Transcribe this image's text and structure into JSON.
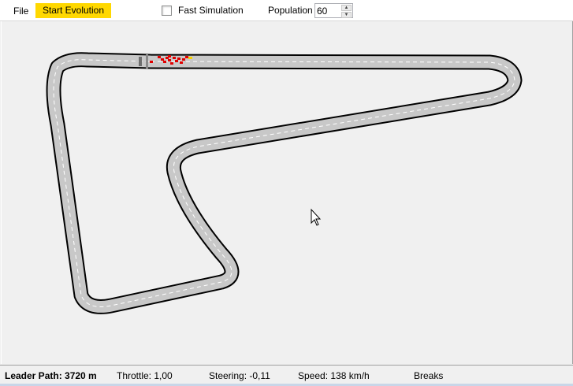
{
  "toolbar": {
    "file_label": "File",
    "start_label": "Start Evolution",
    "start_color": "#ffd800",
    "fast_sim_label": "Fast Simulation",
    "fast_sim_checked": false,
    "population_label": "Population",
    "population_value": "60"
  },
  "track": {
    "road_color": "#c8c8c8",
    "edge_color": "#000000",
    "centerline_color": "#ffffff",
    "car_color": "#e00000",
    "leader_color": "#f5d000",
    "start_marker_color": "#6e6e6e"
  },
  "status": {
    "leader_path": "Leader Path: 3720 m",
    "throttle": "Throttle: 1,00",
    "steering": "Steering: -0,11",
    "speed": "Speed: 138 km/h",
    "breaks": "Breaks"
  },
  "icons": [
    "checkbox-icon",
    "spinner-up-icon",
    "spinner-down-icon",
    "mouse-cursor-icon"
  ]
}
